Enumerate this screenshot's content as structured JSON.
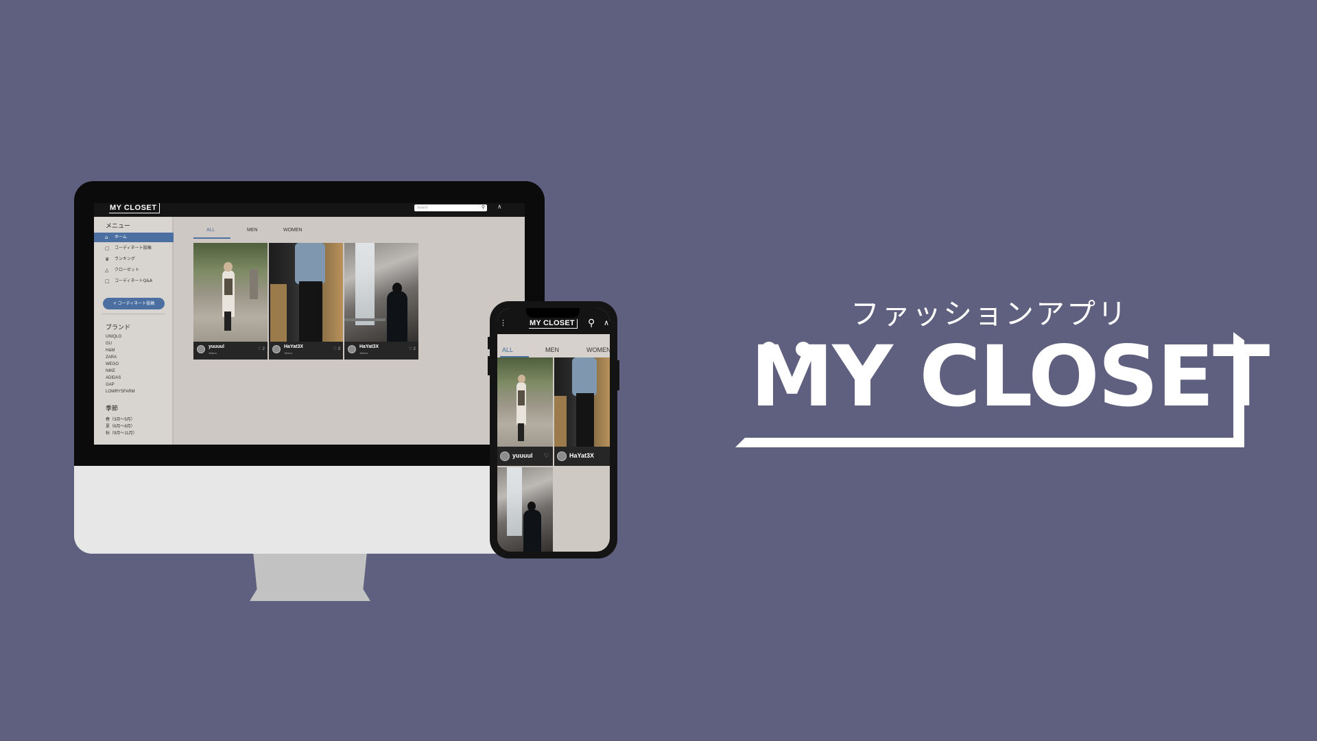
{
  "colors": {
    "background": "#5f5f7f",
    "accent": "#4a6fa0",
    "header": "#151515",
    "content": "#cdc8c3"
  },
  "desktop": {
    "logo": "MY CLOSET",
    "search_placeholder": "Search",
    "icons": {
      "search": "search-icon",
      "notification": "bell-icon"
    },
    "sidebar": {
      "menu_title": "メニュー",
      "menu_items": [
        {
          "label": "ホーム",
          "icon": "home-icon",
          "active": true
        },
        {
          "label": "コーディネート投稿",
          "icon": "post-icon",
          "active": false
        },
        {
          "label": "ランキング",
          "icon": "crown-icon",
          "active": false
        },
        {
          "label": "クローゼット",
          "icon": "closet-icon",
          "active": false
        },
        {
          "label": "コーディネートQ&A",
          "icon": "chat-icon",
          "active": false
        }
      ],
      "post_button": "+ コーディネート投稿",
      "brand_title": "ブランド",
      "brands": [
        "UNIQLO",
        "GU",
        "H&M",
        "ZARA",
        "WEGO",
        "NIKE",
        "ADIDAS",
        "GAP",
        "LOWRYSFARM"
      ],
      "season_title": "季節",
      "seasons": [
        "春（3月〜5月）",
        "夏（6月〜8月）",
        "秋（9月〜11月）"
      ]
    },
    "tabs": [
      "ALL",
      "MEN",
      "WOMEN"
    ],
    "active_tab": "ALL",
    "cards": [
      {
        "username": "yuuuul",
        "height": "166cm",
        "likes": "2"
      },
      {
        "username": "HaYat3X",
        "height": "180cm",
        "likes": "3"
      },
      {
        "username": "HaYat3X",
        "height": "180cm",
        "likes": "2"
      }
    ]
  },
  "mobile": {
    "logo": "MY CLOSET",
    "icons": {
      "menu": "menu-icon",
      "search": "search-icon",
      "notification": "bell-icon"
    },
    "tabs": [
      "ALL",
      "MEN",
      "WOMEN"
    ],
    "active_tab": "ALL",
    "cards": [
      {
        "username": "yuuuul"
      },
      {
        "username": "HaYat3X"
      },
      {
        "username": ""
      }
    ]
  },
  "branding": {
    "tagline": "ファッションアプリ",
    "wordmark": "MY CLOSET"
  }
}
